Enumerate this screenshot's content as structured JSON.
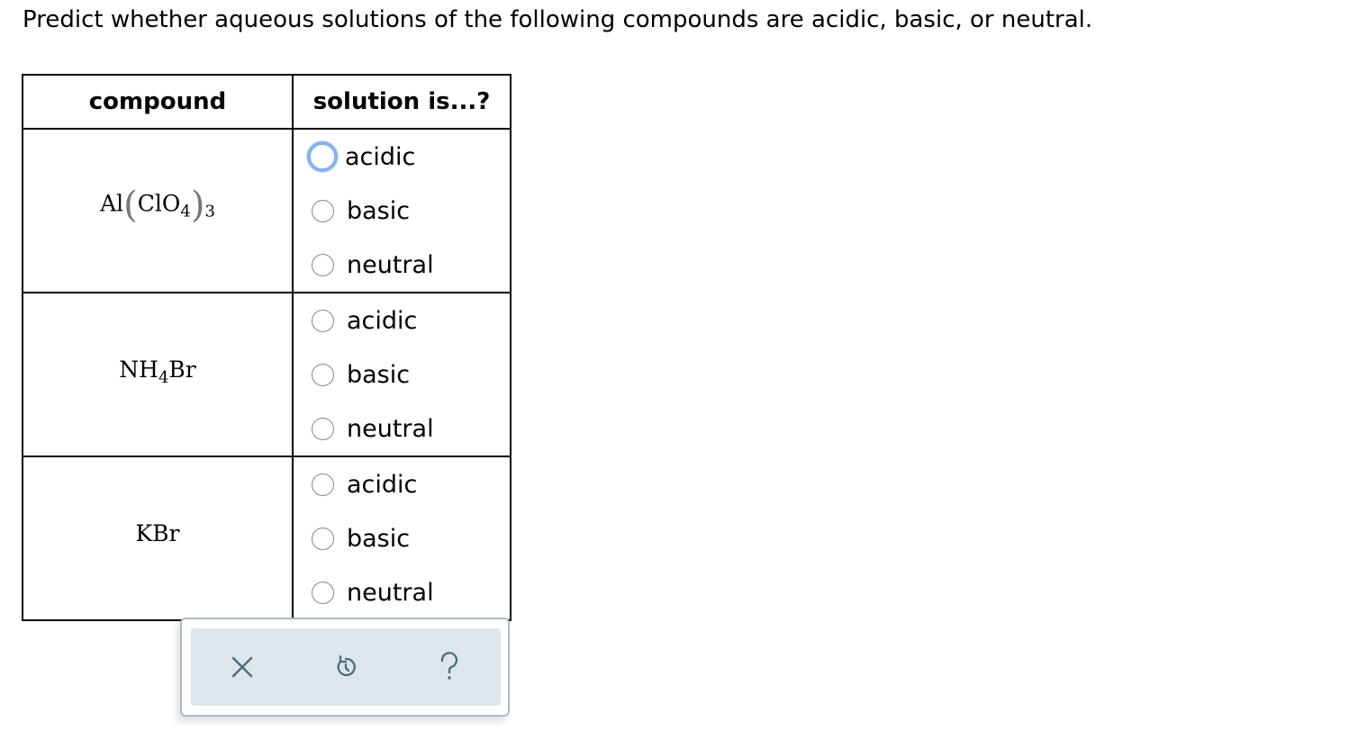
{
  "prompt": "Predict whether aqueous solutions of the following compounds are acidic, basic, or neutral.",
  "table": {
    "headers": [
      "compound",
      "solution is...?"
    ],
    "rows": [
      {
        "formula_parts": [
          "Al",
          "(",
          "ClO",
          "4",
          ")",
          "3"
        ],
        "options": [
          "acidic",
          "basic",
          "neutral"
        ]
      },
      {
        "formula_parts": [
          "NH",
          "4",
          "Br"
        ],
        "options": [
          "acidic",
          "basic",
          "neutral"
        ]
      },
      {
        "formula_parts": [
          "KBr"
        ],
        "options": [
          "acidic",
          "basic",
          "neutral"
        ]
      }
    ]
  },
  "toolbar": {
    "icons": [
      "close-icon",
      "undo-icon",
      "help-icon"
    ]
  },
  "colors": {
    "focus_ring": "#86b2ec",
    "toolbar_bg": "#dde6ea",
    "toolbar_border": "#a9bcc6",
    "icon": "#4b6e7d"
  }
}
